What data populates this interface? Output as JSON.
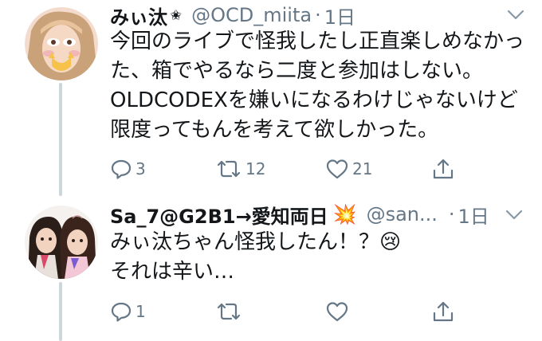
{
  "tweets": [
    {
      "display_name": "みぃ汰",
      "badge": "✬",
      "handle": "@OCD_miita",
      "separator": "·",
      "time": "1日",
      "text": "今回のライブで怪我したし正直楽しめなかった、箱でやるなら二度と参加はしない。\nOLDCODEXを嫌いになるわけじゃないけど限度ってもんを考えて欲しかった。",
      "reply_count": "3",
      "retweet_count": "12",
      "like_count": "21"
    },
    {
      "display_name": "Sa_7@G2B1→愛知両日",
      "emoji": "💥",
      "handle": "@san...",
      "separator": "·",
      "time": "1日",
      "text": "みぃ汰ちゃん怪我したん！？😢\nそれは辛い…",
      "reply_count": "1",
      "retweet_count": "",
      "like_count": ""
    }
  ],
  "icons": {
    "reply": "reply-icon",
    "retweet": "retweet-icon",
    "like": "heart-icon",
    "share": "share-icon",
    "menu": "chevron-down-icon"
  },
  "colors": {
    "text": "#14171a",
    "secondary": "#657786",
    "thread_line": "#ccd6dd"
  }
}
